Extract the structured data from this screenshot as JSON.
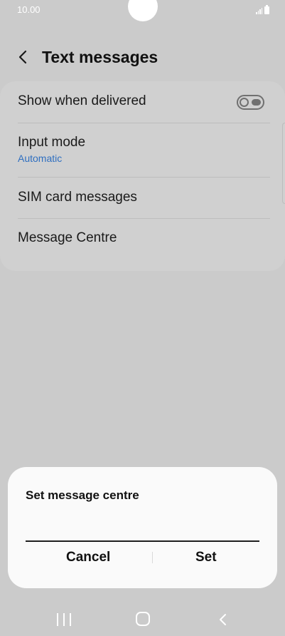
{
  "status_bar": {
    "time": "10.00",
    "icons": [
      "signal-icon",
      "battery-icon"
    ]
  },
  "header": {
    "title": "Text messages",
    "back_icon": "chevron-left-icon"
  },
  "settings": {
    "items": [
      {
        "label": "Show when delivered",
        "toggle_on": false
      },
      {
        "label": "Input mode",
        "sublabel": "Automatic"
      },
      {
        "label": "SIM card messages"
      },
      {
        "label": "Message Centre"
      }
    ]
  },
  "dialog": {
    "title": "Set message centre",
    "input_value": "",
    "cancel_label": "Cancel",
    "set_label": "Set"
  },
  "nav_bar": {
    "icons": [
      "recent-apps-icon",
      "home-icon",
      "back-icon"
    ]
  },
  "colors": {
    "background": "#cbcbcb",
    "card": "#d0d0d0",
    "dialog": "#fafafa",
    "accent": "#2f6fc0",
    "toggle_off": "#707070"
  }
}
